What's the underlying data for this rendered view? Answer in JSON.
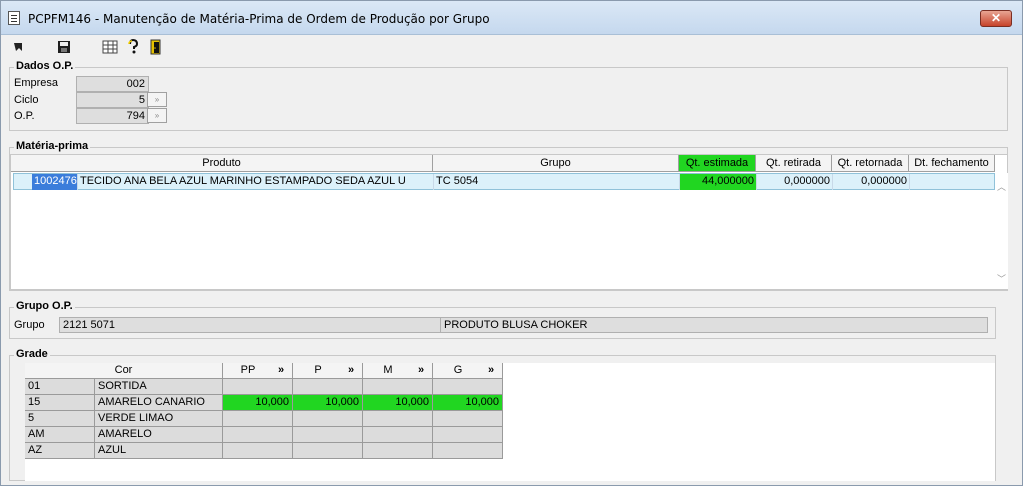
{
  "window": {
    "title": "PCPFM146 - Manutenção de Matéria-Prima de Ordem de Produção por Grupo",
    "close_label": "✕"
  },
  "toolbar": {
    "icons": [
      "arrow-cursor-icon",
      "save-icon",
      "calculator-icon",
      "help-icon",
      "exit-door-icon"
    ]
  },
  "dados_op": {
    "legend": "Dados O.P.",
    "empresa_label": "Empresa",
    "empresa_value": "002",
    "ciclo_label": "Ciclo",
    "ciclo_value": "5",
    "op_label": "O.P.",
    "op_value": "794",
    "lookup_glyph": "»"
  },
  "materia_prima": {
    "legend": "Matéria-prima",
    "columns": [
      "Produto",
      "Grupo",
      "Qt. estimada",
      "Qt. retirada",
      "Qt. retornada",
      "Dt. fechamento"
    ],
    "rows": [
      {
        "codigo": "1002476",
        "produto": "TECIDO ANA BELA AZUL MARINHO ESTAMPADO SEDA AZUL U",
        "grupo": "TC 5054",
        "qt_estimada": "44,000000",
        "qt_retirada": "0,000000",
        "qt_retornada": "0,000000",
        "dt_fechamento": ""
      }
    ]
  },
  "grupo_op": {
    "legend": "Grupo O.P.",
    "grupo_label": "Grupo",
    "grupo_code": "2121 5071",
    "grupo_desc": "PRODUTO BLUSA CHOKER"
  },
  "grade": {
    "legend": "Grade",
    "cor_header": "Cor",
    "sizes": [
      "PP",
      "P",
      "M",
      "G"
    ],
    "size_arrow": "»",
    "rows": [
      {
        "code": "01",
        "name": "SORTIDA",
        "values": [
          "",
          "",
          "",
          ""
        ]
      },
      {
        "code": "15",
        "name": "AMARELO CANARIO",
        "values": [
          "10,000",
          "10,000",
          "10,000",
          "10,000"
        ]
      },
      {
        "code": "5",
        "name": "VERDE LIMAO",
        "values": [
          "",
          "",
          "",
          ""
        ]
      },
      {
        "code": "AM",
        "name": "AMARELO",
        "values": [
          "",
          "",
          "",
          ""
        ]
      },
      {
        "code": "AZ",
        "name": "AZUL",
        "values": [
          "",
          "",
          "",
          ""
        ]
      }
    ]
  },
  "colors": {
    "highlight_green": "#21d621",
    "selection_blue": "#dcf1fa"
  }
}
